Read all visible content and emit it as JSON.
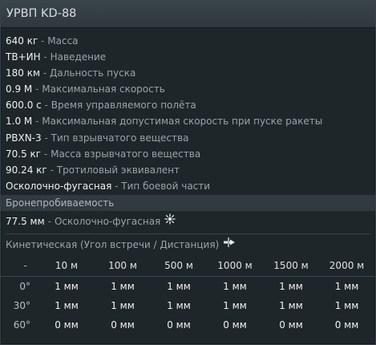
{
  "title": "УРВП KD-88",
  "properties": [
    {
      "value": "640 кг",
      "label": "Масса"
    },
    {
      "value": "ТВ+ИН",
      "label": "Наведение"
    },
    {
      "value": "180 км",
      "label": "Дальность пуска"
    },
    {
      "value": "0.9 М",
      "label": "Максимальная скорость"
    },
    {
      "value": "600.0 с",
      "label": "Время управляемого полёта"
    },
    {
      "value": "1.0 М",
      "label": "Максимальная допустимая скорость при пуске ракеты"
    },
    {
      "value": "PBXN-3",
      "label": "Тип взрывчатого вещества"
    },
    {
      "value": "70.5 кг",
      "label": "Масса взрывчатого вещества"
    },
    {
      "value": "90.24 кг",
      "label": "Тротиловый эквивалент"
    },
    {
      "value": "Осколочно-фугасная",
      "label": "Тип боевой части"
    }
  ],
  "separator": "-",
  "armor_section": {
    "header": "Бронепробиваемость",
    "he_value": "77.5 мм",
    "he_label": "Осколочно-фугасная",
    "he_icon": "explosion-icon"
  },
  "kinetic": {
    "title": "Кинетическая (Угол встречи / Дистанция)",
    "icon": "penetration-icon",
    "corner": "-",
    "columns": [
      "10 м",
      "100 м",
      "500 м",
      "1000 м",
      "1500 м",
      "2000 м"
    ],
    "rows": [
      {
        "angle": "0°",
        "values": [
          "1 мм",
          "1 мм",
          "1 мм",
          "1 мм",
          "1 мм",
          "1 мм"
        ]
      },
      {
        "angle": "30°",
        "values": [
          "1 мм",
          "1 мм",
          "1 мм",
          "1 мм",
          "1 мм",
          "1 мм"
        ]
      },
      {
        "angle": "60°",
        "values": [
          "0 мм",
          "0 мм",
          "0 мм",
          "0 мм",
          "0 мм",
          "0 мм"
        ]
      }
    ]
  },
  "colors": {
    "background": "#1f262a",
    "titlebar": "#3a444b",
    "section_header": "#313a40",
    "value_text": "#eef1f2",
    "label_text": "#9aa3a9"
  }
}
